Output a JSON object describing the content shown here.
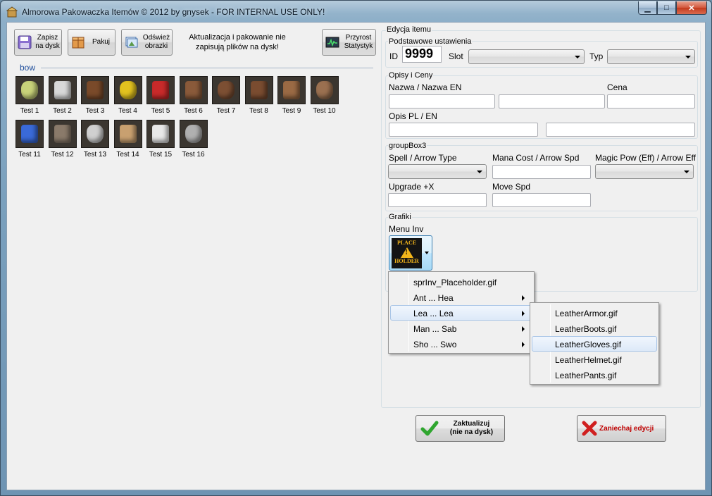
{
  "window": {
    "title": "Almorowa Pakowaczka Itemów © 2012 by gnysek - FOR INTERNAL USE ONLY!",
    "minimize": "▁",
    "maximize": "□",
    "close": "✕"
  },
  "toolbar": {
    "save_label": "Zapisz\nna dysk",
    "pack_label": "Pakuj",
    "refresh_label": "Odśwież\nobrazki",
    "notice": "Aktualizacja i pakowanie nie zapisują plików na dysk!",
    "stats_label": "Przyrost\nStatystyk"
  },
  "items_panel": {
    "category": "bow",
    "items": [
      {
        "label": "Test 1",
        "icon": "potion-icon",
        "color": "#c9d37a"
      },
      {
        "label": "Test 2",
        "icon": "axe-icon",
        "color": "#d8d8d8"
      },
      {
        "label": "Test 3",
        "icon": "staff-icon",
        "color": "#7a4a2a"
      },
      {
        "label": "Test 4",
        "icon": "gold-coins-icon",
        "color": "#e2c21f"
      },
      {
        "label": "Test 5",
        "icon": "red-potion-icon",
        "color": "#c82a2a"
      },
      {
        "label": "Test 6",
        "icon": "leather-armor-icon",
        "color": "#8a5a3a"
      },
      {
        "label": "Test 7",
        "icon": "leather-boots-icon",
        "color": "#7c4f33"
      },
      {
        "label": "Test 8",
        "icon": "leather-gloves-icon",
        "color": "#7a4c30"
      },
      {
        "label": "Test 9",
        "icon": "leather-helmet-icon",
        "color": "#9a6a44"
      },
      {
        "label": "Test 10",
        "icon": "leather-pants-icon",
        "color": "#9a7050"
      },
      {
        "label": "Test 11",
        "icon": "blue-potion-icon",
        "color": "#3a6ad8"
      },
      {
        "label": "Test 12",
        "icon": "stone-shield-icon",
        "color": "#8a7a6a"
      },
      {
        "label": "Test 13",
        "icon": "iron-helmet-icon",
        "color": "#d0d0d0"
      },
      {
        "label": "Test 14",
        "icon": "wooden-shield-icon",
        "color": "#c8a070"
      },
      {
        "label": "Test 15",
        "icon": "scimitar-icon",
        "color": "#e8e8e8"
      },
      {
        "label": "Test 16",
        "icon": "dagger-icon",
        "color": "#b0b0b0"
      }
    ]
  },
  "edit": {
    "section_title": "Edycja itemu",
    "basic": {
      "title": "Podstawowe ustawienia",
      "id_label": "ID",
      "id_value": "9999",
      "slot_label": "Slot",
      "slot_value": "",
      "type_label": "Typ",
      "type_value": ""
    },
    "descriptions": {
      "title": "Opisy i Ceny",
      "name_label": "Nazwa / Nazwa EN",
      "price_label": "Cena",
      "desc_label": "Opis PL / EN",
      "name_pl": "",
      "name_en": "",
      "price": "",
      "desc_pl": "",
      "desc_en": ""
    },
    "group3": {
      "title": "groupBox3",
      "spell_label": "Spell / Arrow Type",
      "mana_label": "Mana Cost / Arrow Spd",
      "magic_label": "Magic Pow (Eff) / Arrow Eff",
      "upgrade_label": "Upgrade +X",
      "move_label": "Move Spd",
      "spell_value": "",
      "mana_value": "",
      "magic_value": "",
      "upgrade_value": "",
      "move_value": ""
    },
    "graphics": {
      "title": "Grafiki",
      "menu_inv_label": "Menu Inv",
      "placeholder_top": "PLACE",
      "placeholder_bottom": "HOLDER",
      "warn_glyph": "!"
    }
  },
  "dropdown_menu": {
    "items": [
      {
        "label": "sprInv_Placeholder.gif",
        "has_sub": false
      },
      {
        "label": "Ant ... Hea",
        "has_sub": true
      },
      {
        "label": "Lea ... Lea",
        "has_sub": true,
        "highlighted": true
      },
      {
        "label": "Man ... Sab",
        "has_sub": true
      },
      {
        "label": "Sho ... Swo",
        "has_sub": true
      }
    ],
    "submenu": [
      {
        "label": "LeatherArmor.gif"
      },
      {
        "label": "LeatherBoots.gif"
      },
      {
        "label": "LeatherGloves.gif",
        "highlighted": true
      },
      {
        "label": "LeatherHelmet.gif"
      },
      {
        "label": "LeatherPants.gif"
      }
    ]
  },
  "actions": {
    "update_label": "Zaktualizuj\n(nie na dysk)",
    "cancel_label": "Zaniechaj edycji"
  },
  "colors": {
    "accent": "#1f4e9c",
    "cancel_text": "#c00000",
    "check": "#2fa62f",
    "cross": "#d02020"
  }
}
